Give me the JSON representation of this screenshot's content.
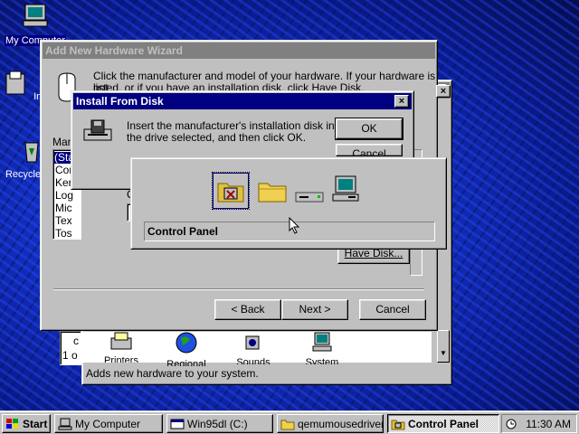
{
  "desktop": {
    "icons": [
      {
        "label": "My Computer"
      },
      {
        "label": "Inbox"
      },
      {
        "label": "Recycle Bin"
      }
    ]
  },
  "control_panel_window": {
    "status_text": "Adds new hardware to your system.",
    "items": [
      {
        "label": "Printers"
      },
      {
        "label": "Regional"
      },
      {
        "label": "Sounds"
      },
      {
        "label": "System"
      }
    ],
    "left_fragment": "c",
    "left_fragment2": "1 o"
  },
  "wizard": {
    "title": "Add New Hardware Wizard",
    "instructions_line1": "Click the manufacturer and model of your hardware. If your hardware is not",
    "instructions_line2": "listed, or if you have an installation disk, click Have Disk.",
    "manufacturers_label": "Man",
    "list_items": [
      "(Sta",
      "Com",
      "Ker",
      "Log",
      "Mic",
      "Tex",
      "Tos"
    ],
    "models_label_fragment": "C",
    "have_disk_label": "Have Disk...",
    "back_label": "< Back",
    "next_label": "Next >",
    "cancel_label": "Cancel"
  },
  "install_dialog": {
    "title": "Install From Disk",
    "close_glyph": "×",
    "message_line1": "Insert the manufacturer's installation disk into",
    "message_line2": "the drive selected, and then click OK.",
    "ok_label": "OK",
    "cancel_label": "Cancel"
  },
  "browse_popup": {
    "selected_location": "Control Panel",
    "icons": [
      "control-panel-folder-icon",
      "folder-icon",
      "drive-icon",
      "computer-icon"
    ]
  },
  "taskbar": {
    "start_label": "Start",
    "tasks": [
      {
        "label": "My Computer",
        "pressed": false
      },
      {
        "label": "Win95dl (C:)",
        "pressed": false
      },
      {
        "label": "qemumousedriver",
        "pressed": false
      },
      {
        "label": "Control Panel",
        "pressed": true
      }
    ],
    "clock": "11:30 AM"
  }
}
